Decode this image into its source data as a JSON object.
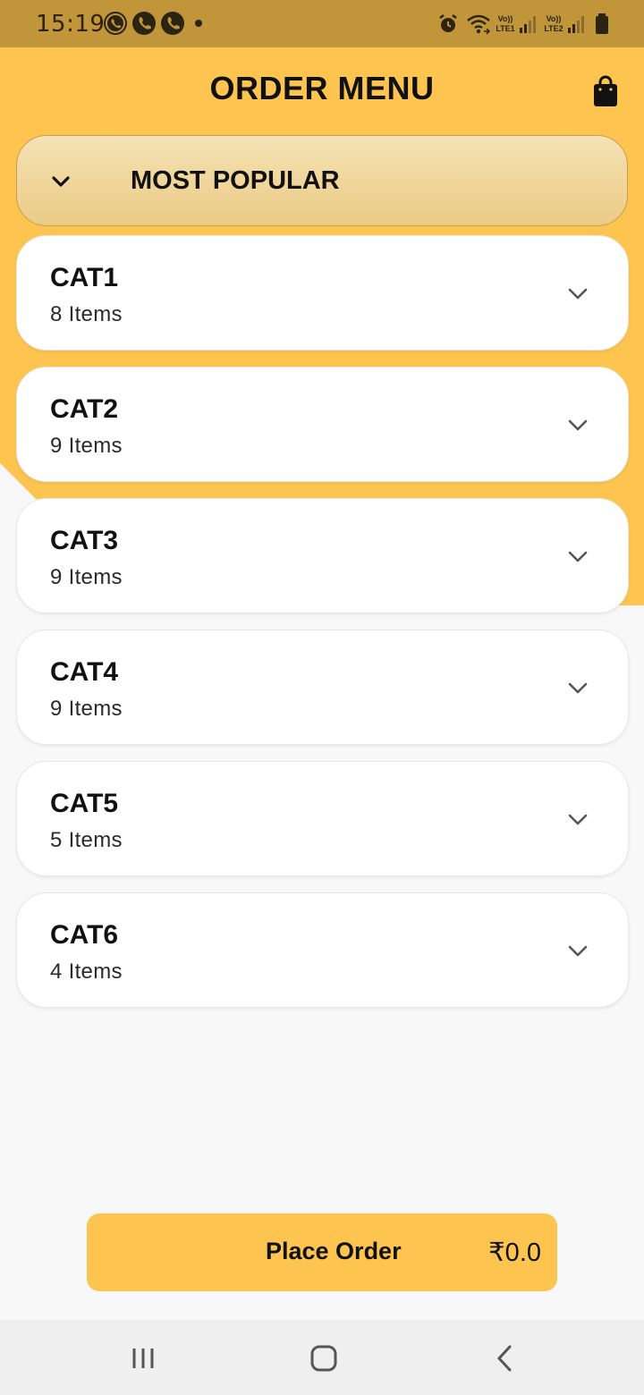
{
  "status_bar": {
    "time": "15:19",
    "sim1_text": "Vo))",
    "sim1_label": "LTE1",
    "sim2_text": "Vo))",
    "sim2_label": "LTE2",
    "icons": [
      "whatsapp-icon",
      "phone-icon",
      "phone-icon",
      "notification-dot",
      "alarm-icon",
      "wifi-icon",
      "signal-icon",
      "signal-icon",
      "battery-icon"
    ]
  },
  "header": {
    "title": "ORDER MENU",
    "cart_icon": "shopping-bag-icon"
  },
  "popular": {
    "label": "MOST POPULAR"
  },
  "categories": [
    {
      "name": "CAT1",
      "count": "8 Items"
    },
    {
      "name": "CAT2",
      "count": "9 Items"
    },
    {
      "name": "CAT3",
      "count": "9 Items"
    },
    {
      "name": "CAT4",
      "count": "9 Items"
    },
    {
      "name": "CAT5",
      "count": "5 Items"
    },
    {
      "name": "CAT6",
      "count": "4 Items"
    }
  ],
  "footer": {
    "button_label": "Place Order",
    "total": "₹0.0"
  },
  "navigation": {
    "icons": [
      "recent-apps-icon",
      "home-icon",
      "back-icon"
    ]
  },
  "colors": {
    "accent": "#fdc450",
    "status_bar": "#c1953a",
    "background": "#f8f8f8"
  }
}
